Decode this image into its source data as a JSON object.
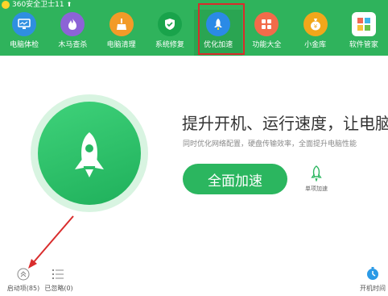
{
  "app": {
    "title": "360安全卫士11"
  },
  "nav": {
    "items": [
      {
        "label": "电脑体检",
        "icon": "monitor-icon",
        "color": "#2f8fe0"
      },
      {
        "label": "木马查杀",
        "icon": "flame-icon",
        "color": "#8c63d6"
      },
      {
        "label": "电脑清理",
        "icon": "broom-icon",
        "color": "#f29b28"
      },
      {
        "label": "系统修复",
        "icon": "shield-icon",
        "color": "#19a34b"
      },
      {
        "label": "优化加速",
        "icon": "rocket-icon",
        "color": "#2b8ae6",
        "selected": true
      },
      {
        "label": "功能大全",
        "icon": "grid-icon",
        "color": "#f26b4a"
      },
      {
        "label": "小金库",
        "icon": "money-bag-icon",
        "color": "#f2a71b"
      },
      {
        "label": "软件管家",
        "icon": "apps-icon",
        "color": "#e4a33b"
      }
    ]
  },
  "main": {
    "headline": "提升开机、运行速度，让电脑快",
    "subline": "同时优化网络配置，硬盘传输效率，全面提升电脑性能",
    "boost_button": "全面加速",
    "single_label": "单项加速"
  },
  "bottom": {
    "startup_label": "启动项(85)",
    "ignored_label": "已忽略(0)",
    "boot_time_label": "开机时间"
  }
}
